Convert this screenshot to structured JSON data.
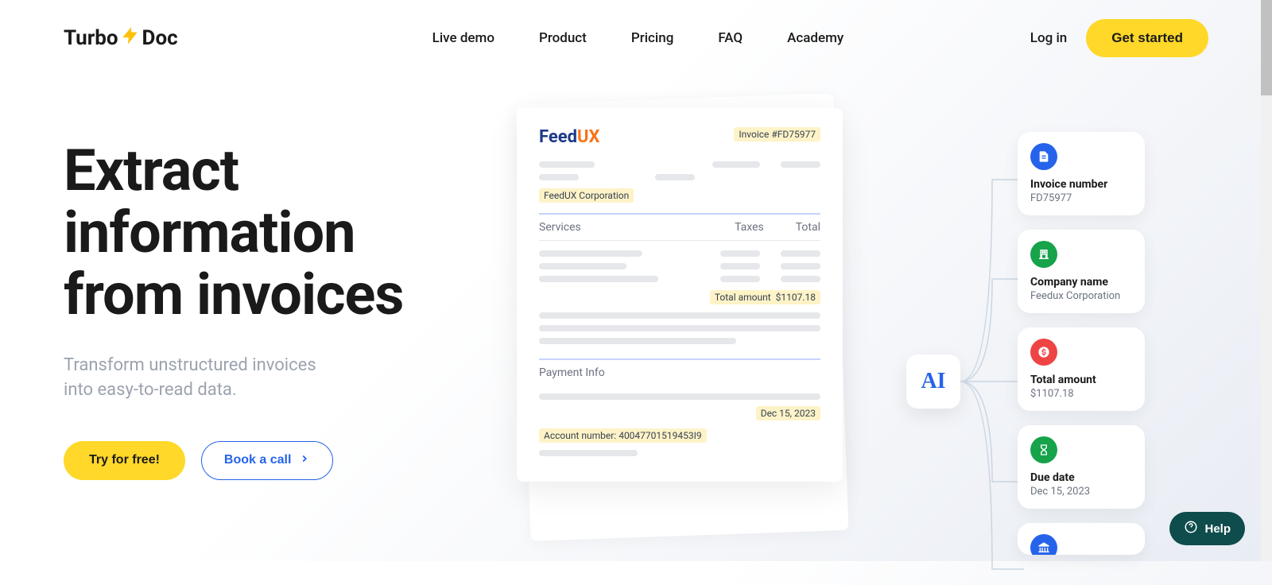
{
  "logo": {
    "part1": "Turbo",
    "part2": "Doc"
  },
  "nav": {
    "live_demo": "Live demo",
    "product": "Product",
    "pricing": "Pricing",
    "faq": "FAQ",
    "academy": "Academy"
  },
  "header": {
    "login": "Log in",
    "get_started": "Get started"
  },
  "hero": {
    "title_line1": "Extract",
    "title_line2": "information",
    "title_line3": "from invoices",
    "subtitle_line1": "Transform unstructured invoices",
    "subtitle_line2": "into easy-to-read data.",
    "try_free": "Try for free!",
    "book_call": "Book a call"
  },
  "doc": {
    "logo_feed": "Feed",
    "logo_ux": "UX",
    "invoice_label": "Invoice #FD75977",
    "company": "FeedUX Corporation",
    "col_services": "Services",
    "col_taxes": "Taxes",
    "col_total": "Total",
    "total_label": "Total amount",
    "total_value": "$1107.18",
    "payment_title": "Payment Info",
    "date": "Dec 15, 2023",
    "account": "Account number: 40047701519453I9"
  },
  "ai": {
    "label": "AI"
  },
  "cards": [
    {
      "title": "Invoice number",
      "value": "FD75977"
    },
    {
      "title": "Company name",
      "value": "Feedux Corporation"
    },
    {
      "title": "Total amount",
      "value": "$1107.18"
    },
    {
      "title": "Due date",
      "value": "Dec 15, 2023"
    }
  ],
  "help": {
    "label": "Help"
  }
}
